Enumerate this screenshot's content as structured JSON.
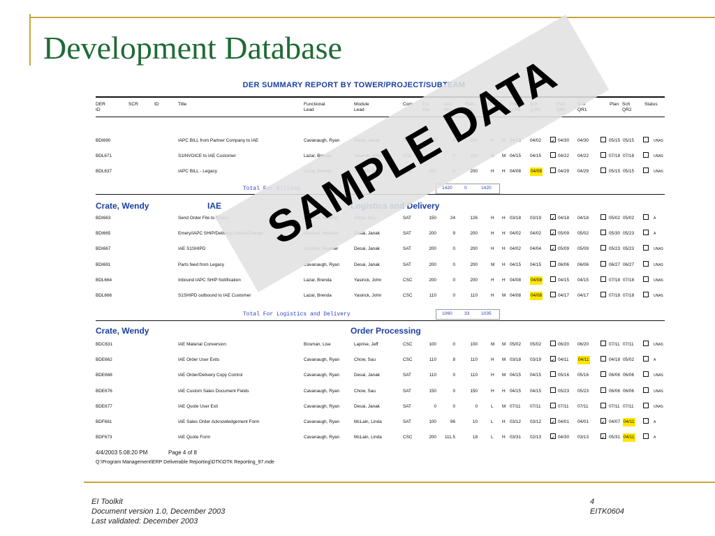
{
  "slide": {
    "title": "Development Database",
    "footer": {
      "org": "EI Toolkit",
      "version": "Document version 1.0, December 2003",
      "validated": "Last validated: December 2003",
      "page": "4",
      "code": "EITK0604"
    }
  },
  "report": {
    "title": "DER SUMMARY REPORT BY TOWER/PROJECT/SUBTEAM",
    "headers": {
      "der": [
        "DER",
        "ID"
      ],
      "scr": [
        "SCR",
        ""
      ],
      "id": [
        "ID",
        ""
      ],
      "title": [
        "Title",
        ""
      ],
      "func": [
        "Functional",
        "Lead"
      ],
      "module": [
        "Module",
        "Lead"
      ],
      "com": [
        "Com",
        ""
      ],
      "est": [
        "Est",
        "Hrs."
      ],
      "act": [
        "Act",
        "Hrs"
      ],
      "rem": [
        "Rem",
        "Hrs."
      ],
      "pr": [
        "PR.",
        ""
      ],
      "co": [
        "C",
        "O"
      ],
      "plan_qr0": [
        "Plan",
        "Q R0"
      ],
      "sch_qr0": [
        "Sch",
        "Q R0"
      ],
      "plan_qr1": [
        "Plan",
        "QR1"
      ],
      "sch_qr1": [
        "Sch",
        "QR1"
      ],
      "plan_qr2": [
        "Plan",
        ""
      ],
      "sch_qr2": [
        "Sch",
        "QR2"
      ],
      "status": [
        "Status",
        ""
      ]
    },
    "billing_rows": [
      {
        "der": "BDI690",
        "title": "IAPC BILL from Partner Company to IAE",
        "func": "Cavanaugh, Ryan",
        "module": "Desai, Janak",
        "com": "SAT",
        "est": "200",
        "act": "0",
        "rem": "200",
        "pr": "H",
        "co": "H",
        "pqr0": "04/15",
        "sqr0": "04/02",
        "c1": "✓",
        "pqr1": "04/30",
        "sqr1": "04/30",
        "c2": "",
        "pqr2": "05/15",
        "sqr2": "05/15",
        "c3": "",
        "status": "UNAS"
      },
      {
        "der": "BDL671",
        "title": "S1INVOICE to IAE Customer",
        "func": "Lazar, Brenda",
        "module": "Yasinck, John",
        "com": "CSC",
        "est": "110",
        "act": "0",
        "rem": "110",
        "pr": "H",
        "co": "M",
        "pqr0": "04/15",
        "sqr0": "04/15",
        "c1": "",
        "pqr1": "04/22",
        "sqr1": "04/22",
        "c2": "",
        "pqr2": "07/18",
        "sqr2": "07/18",
        "c3": "",
        "status": "UNAS"
      },
      {
        "der": "BDL637",
        "title": "IAPC BILL - Legacy",
        "func": "Lazar, Brenda",
        "module": "Yasinck, John",
        "com": "CSC",
        "est": "200",
        "act": "0",
        "rem": "200",
        "pr": "H",
        "co": "H",
        "pqr0": "04/08",
        "sqr0": "04/08",
        "hl0": true,
        "c1": "",
        "pqr1": "04/29",
        "sqr1": "04/29",
        "c2": "",
        "pqr2": "05/15",
        "sqr2": "05/15",
        "c3": "",
        "status": "UNAS"
      }
    ],
    "billing_total": {
      "label": "Total For Billing",
      "est": "1420",
      "act": "0",
      "rem": "1420"
    },
    "group1": {
      "lead": "Crate, Wendy",
      "team": "IAE",
      "subteam": "Logistics and Delivery"
    },
    "logistics_rows": [
      {
        "der": "BDI663",
        "title": "Send Order File to Emery",
        "func": "Gardner, Heather",
        "module": "Chow, Sau",
        "com": "SAT",
        "est": "150",
        "act": "24",
        "rem": "126",
        "pr": "H",
        "co": "H",
        "pqr0": "03/18",
        "sqr0": "03/19",
        "c1": "✓",
        "pqr1": "04/18",
        "sqr1": "04/18",
        "c2": "",
        "pqr2": "05/02",
        "sqr2": "05/02",
        "c3": "",
        "status": "A"
      },
      {
        "der": "BDI665",
        "title": "Emery/IAPC SHIP/Delivery Create/Change",
        "func": "Gardner, Heather",
        "module": "Desai, Janak",
        "com": "SAT",
        "est": "200",
        "act": "9",
        "rem": "200",
        "pr": "H",
        "co": "H",
        "pqr0": "04/02",
        "sqr0": "04/02",
        "c1": "✓",
        "pqr1": "05/09",
        "sqr1": "05/02",
        "c2": "",
        "pqr2": "05/30",
        "sqr2": "05/23",
        "c3": "",
        "status": "A"
      },
      {
        "der": "BDI667",
        "title": "IAE S1SHIPD",
        "func": "Gardner, Heather",
        "module": "Desai, Janak",
        "com": "SAT",
        "est": "200",
        "act": "0",
        "rem": "200",
        "pr": "H",
        "co": "H",
        "pqr0": "04/02",
        "sqr0": "04/04",
        "c1": "✓",
        "pqr1": "05/09",
        "sqr1": "05/09",
        "c2": "",
        "pqr2": "05/23",
        "sqr2": "05/23",
        "c3": "",
        "status": "UNAS"
      },
      {
        "der": "BDI691",
        "title": "Parts feed from Legacy",
        "func": "Cavanaugh, Ryan",
        "module": "Desai, Janak",
        "com": "SAT",
        "est": "200",
        "act": "0",
        "rem": "200",
        "pr": "M",
        "co": "H",
        "pqr0": "04/15",
        "sqr0": "04/15",
        "c1": "",
        "pqr1": "06/06",
        "sqr1": "06/06",
        "c2": "",
        "pqr2": "06/27",
        "sqr2": "06/27",
        "c3": "",
        "status": "UNAS"
      },
      {
        "der": "BDL664",
        "title": "Inbound IAPC SHIP Notification",
        "func": "Lazar, Brenda",
        "module": "Yasinck, John",
        "com": "CSC",
        "est": "200",
        "act": "0",
        "rem": "200",
        "pr": "H",
        "co": "H",
        "pqr0": "04/08",
        "sqr0": "04/08",
        "hl0": true,
        "c1": "",
        "pqr1": "04/15",
        "sqr1": "04/15",
        "c2": "",
        "pqr2": "07/18",
        "sqr2": "07/18",
        "c3": "",
        "status": "UNAS"
      },
      {
        "der": "BDL666",
        "title": "S1SHIPD outbound to IAE Customer",
        "func": "Lazar, Brenda",
        "module": "Yasinck, John",
        "com": "CSC",
        "est": "110",
        "act": "0",
        "rem": "110",
        "pr": "H",
        "co": "M",
        "pqr0": "04/08",
        "sqr0": "04/08",
        "hl0": true,
        "c1": "",
        "pqr1": "04/17",
        "sqr1": "04/17",
        "c2": "",
        "pqr2": "07/18",
        "sqr2": "07/18",
        "c3": "",
        "status": "UNAS"
      }
    ],
    "logistics_total": {
      "label": "Total For Logistics and Delivery",
      "est": "1060",
      "act": "33",
      "rem": "1035"
    },
    "group2": {
      "lead": "Crate, Wendy",
      "team": "",
      "subteam": "Order Processing"
    },
    "order_rows": [
      {
        "der": "BDC631",
        "title": "IAE Material Conversion",
        "func": "Bosman, Lise",
        "module": "Laprise, Jeff",
        "com": "CSC",
        "est": "100",
        "act": "0",
        "rem": "100",
        "pr": "M",
        "co": "M",
        "pqr0": "05/02",
        "sqr0": "05/02",
        "c1": "",
        "pqr1": "06/20",
        "sqr1": "06/20",
        "c2": "",
        "pqr2": "07/11",
        "sqr2": "07/11",
        "c3": "",
        "status": "UNAS"
      },
      {
        "der": "BDE662",
        "title": "IAE Order User Exits",
        "func": "Cavanaugh, Ryan",
        "module": "Chow, Sau",
        "com": "CSC",
        "est": "110",
        "act": "8",
        "rem": "110",
        "pr": "H",
        "co": "M",
        "pqr0": "03/18",
        "sqr0": "03/19",
        "c1": "✓",
        "pqr1": "04/11",
        "sqr1": "04/11",
        "hl1": true,
        "c2": "",
        "pqr2": "04/18",
        "sqr2": "05/02",
        "c3": "",
        "status": "A"
      },
      {
        "der": "BDE668",
        "title": "IAE Order/Delivery Copy Control",
        "func": "Cavanaugh, Ryan",
        "module": "Desai, Janak",
        "com": "SAT",
        "est": "110",
        "act": "0",
        "rem": "110",
        "pr": "H",
        "co": "M",
        "pqr0": "04/15",
        "sqr0": "04/15",
        "c1": "",
        "pqr1": "05/16",
        "sqr1": "05/16",
        "c2": "",
        "pqr2": "06/06",
        "sqr2": "06/06",
        "c3": "",
        "status": "UNAS"
      },
      {
        "der": "BDE676",
        "title": "IAE Custom Sales Document Fields",
        "func": "Cavanaugh, Ryan",
        "module": "Chow, Sau",
        "com": "SAT",
        "est": "150",
        "act": "0",
        "rem": "150",
        "pr": "H",
        "co": "H",
        "pqr0": "04/15",
        "sqr0": "04/15",
        "c1": "",
        "pqr1": "05/23",
        "sqr1": "05/23",
        "c2": "",
        "pqr2": "06/06",
        "sqr2": "06/06",
        "c3": "",
        "status": "UNAS"
      },
      {
        "der": "BDE677",
        "title": "IAE Quote User Exit",
        "func": "Cavanaugh, Ryan",
        "module": "Desai, Janak",
        "com": "SAT",
        "est": "0",
        "act": "0",
        "rem": "0",
        "pr": "L",
        "co": "M",
        "pqr0": "07/11",
        "sqr0": "07/11",
        "c1": "",
        "pqr1": "07/11",
        "sqr1": "07/11",
        "c2": "",
        "pqr2": "07/11",
        "sqr2": "07/11",
        "c3": "",
        "status": "UNAS"
      },
      {
        "der": "BDF661",
        "title": "IAE Sales Order Acknowledgement Form",
        "func": "Cavanaugh, Ryan",
        "module": "McLain, Linda",
        "com": "SAT",
        "est": "100",
        "act": "96",
        "rem": "10",
        "pr": "L",
        "co": "H",
        "pqr0": "03/12",
        "sqr0": "03/12",
        "c1": "✓",
        "pqr1": "04/01",
        "sqr1": "04/01",
        "c2": "✓",
        "pqr2": "04/07",
        "sqr2": "04/11",
        "hl2": true,
        "c3": "",
        "status": "A"
      },
      {
        "der": "BDF673",
        "title": "IAE Quote Form",
        "func": "Cavanaugh, Ryan",
        "module": "McLain, Linda",
        "com": "CSC",
        "est": "200",
        "act": "111.5",
        "rem": "18",
        "pr": "L",
        "co": "H",
        "pqr0": "03/31",
        "sqr0": "02/13",
        "c1": "✓",
        "pqr1": "04/30",
        "sqr1": "03/13",
        "c2": "✓",
        "pqr2": "05/31",
        "sqr2": "04/11",
        "hl2": true,
        "c3": "",
        "status": "A"
      }
    ],
    "footer": {
      "timestamp": "4/4/2003 5:08:20 PM",
      "page": "Page 4 of 8",
      "path": "Q:\\Program Management\\ERP Deliverable Reporting\\DTK\\DTK Reporting_97.mde"
    }
  },
  "watermark": "SAMPLE DATA"
}
